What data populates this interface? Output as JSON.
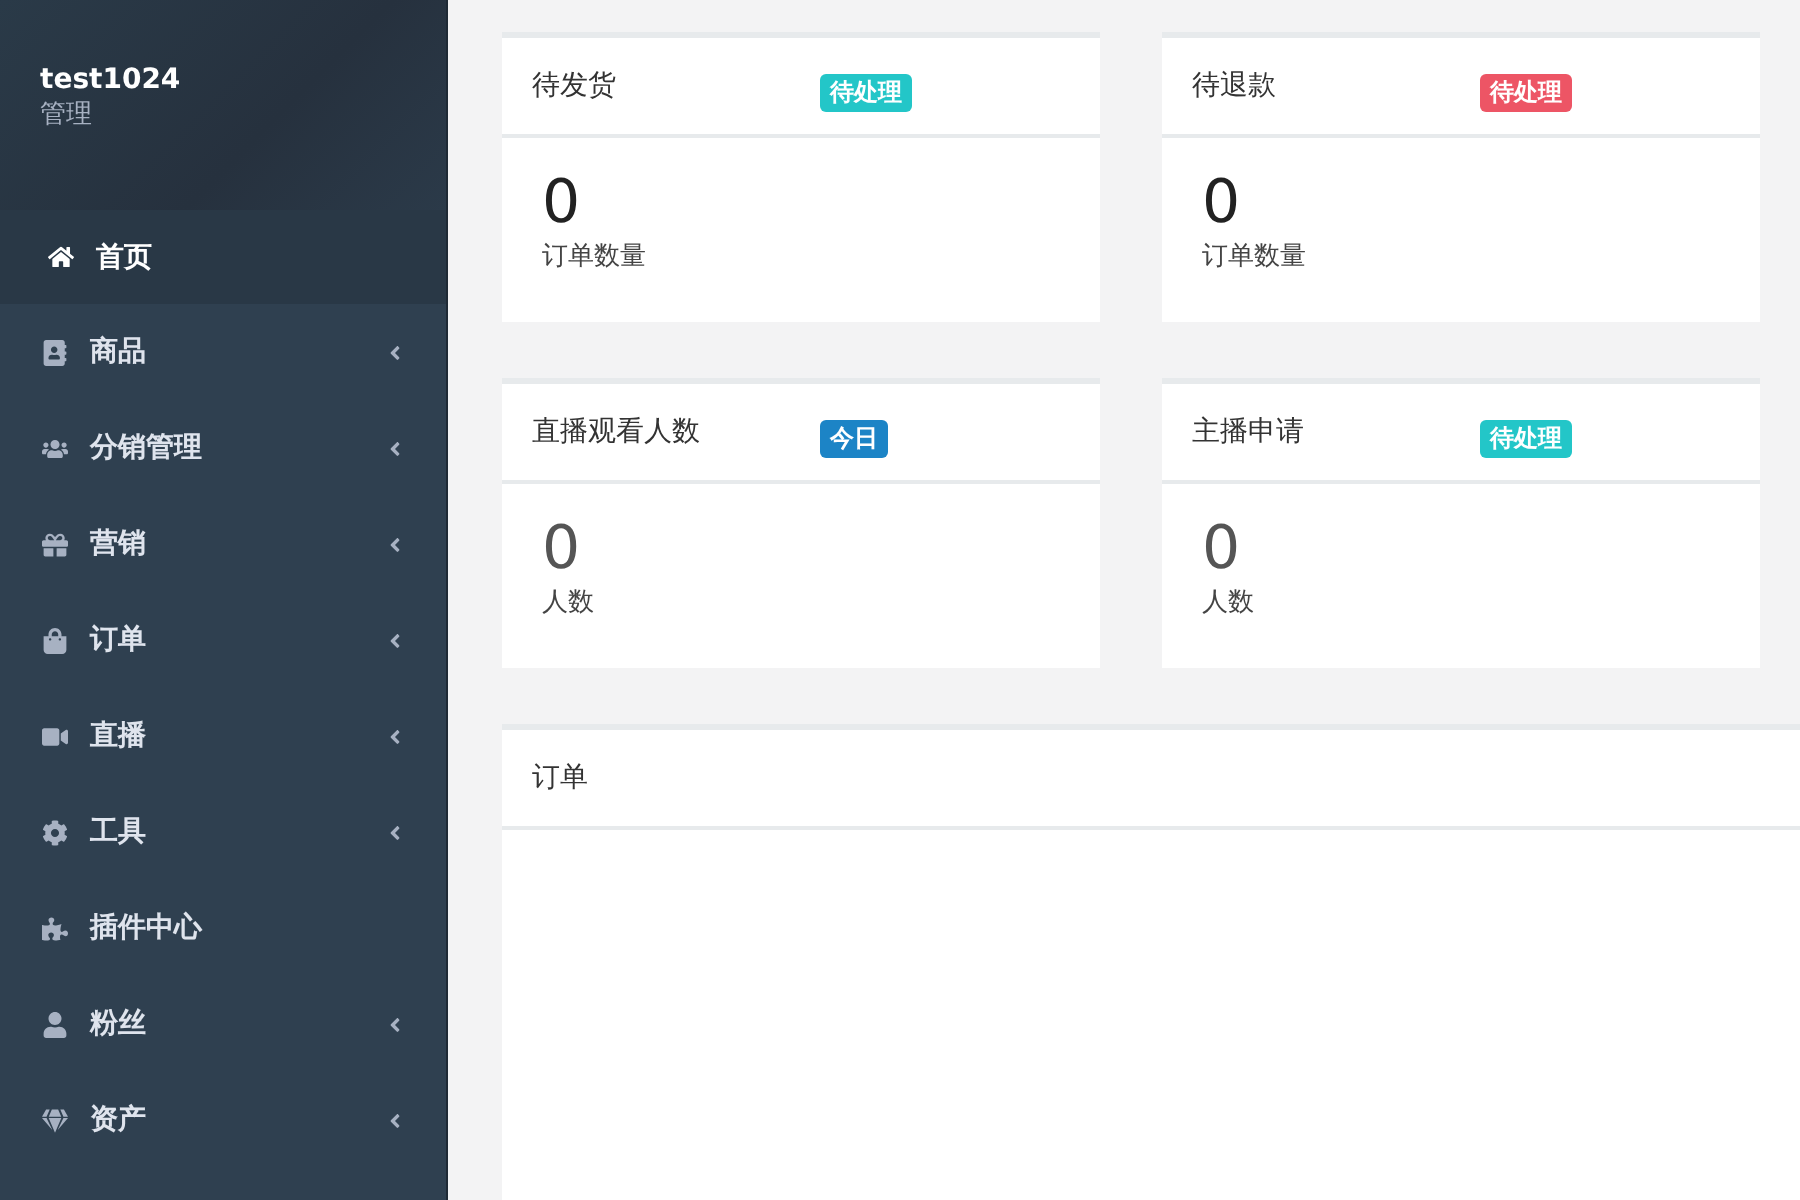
{
  "sidebar": {
    "user": {
      "name": "test1024",
      "role": "管理"
    },
    "items": [
      {
        "label": "首页",
        "selected": true,
        "expandable": false
      },
      {
        "label": "商品",
        "selected": false,
        "expandable": true
      },
      {
        "label": "分销管理",
        "selected": false,
        "expandable": true
      },
      {
        "label": "营销",
        "selected": false,
        "expandable": true
      },
      {
        "label": "订单",
        "selected": false,
        "expandable": true
      },
      {
        "label": "直播",
        "selected": false,
        "expandable": true
      },
      {
        "label": "工具",
        "selected": false,
        "expandable": true
      },
      {
        "label": "插件中心",
        "selected": false,
        "expandable": false
      },
      {
        "label": "粉丝",
        "selected": false,
        "expandable": true
      },
      {
        "label": "资产",
        "selected": false,
        "expandable": true
      }
    ]
  },
  "stat_cards": [
    {
      "title": "待发货",
      "badge": "待处理",
      "color": "#23c6c8",
      "value": "0",
      "caption": "订单数量"
    },
    {
      "title": "待退款",
      "badge": "待处理",
      "color": "#ed5565",
      "value": "0",
      "caption": "订单数量"
    },
    {
      "title": "直播观看人数",
      "badge": "今日",
      "color": "#1c84c6",
      "value": "0",
      "caption": "人数"
    },
    {
      "title": "主播申请",
      "badge": "待处理",
      "color": "#23c6c8",
      "value": "0",
      "caption": "人数"
    }
  ],
  "orders_panel": {
    "title": "订单"
  }
}
